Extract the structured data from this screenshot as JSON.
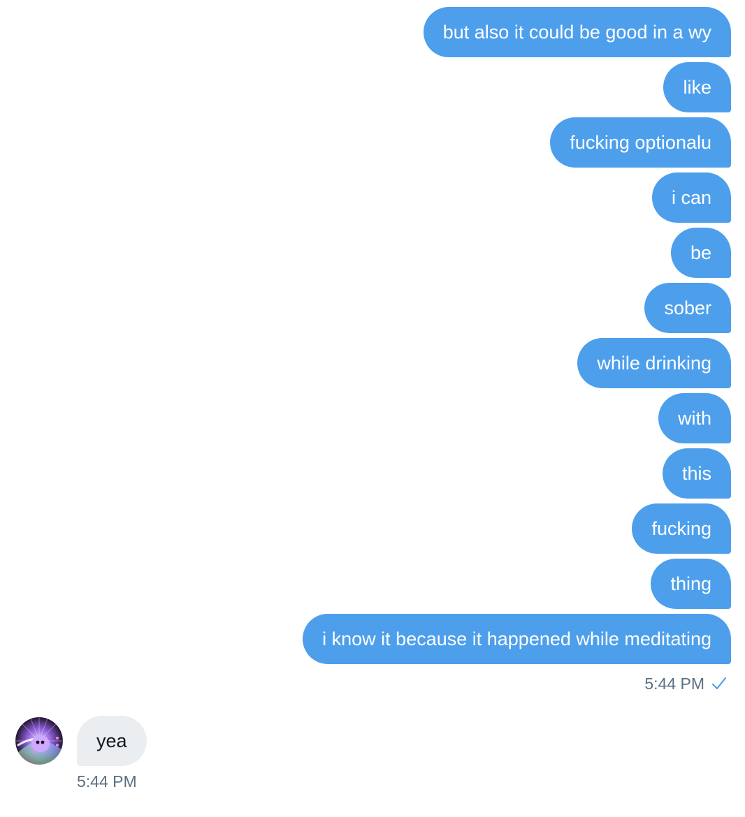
{
  "conversation": {
    "sent_messages": [
      {
        "text": "but also it could be good in a wy"
      },
      {
        "text": "like"
      },
      {
        "text": "fucking optionalu"
      },
      {
        "text": "i can"
      },
      {
        "text": "be"
      },
      {
        "text": "sober"
      },
      {
        "text": "while drinking"
      },
      {
        "text": "with"
      },
      {
        "text": "this"
      },
      {
        "text": "fucking"
      },
      {
        "text": "thing"
      },
      {
        "text": "i know it because it happened while meditating"
      }
    ],
    "sent_time": "5:44 PM",
    "received_messages": [
      {
        "text": "yea"
      }
    ],
    "received_time": "5:44 PM"
  },
  "colors": {
    "sent_bubble": "#4d9fec",
    "received_bubble": "#ebeef0",
    "timestamp": "#5b7083",
    "read_check": "#4d9fec"
  },
  "icons": {
    "read_status": "check-icon",
    "contact_avatar": "avatar"
  }
}
